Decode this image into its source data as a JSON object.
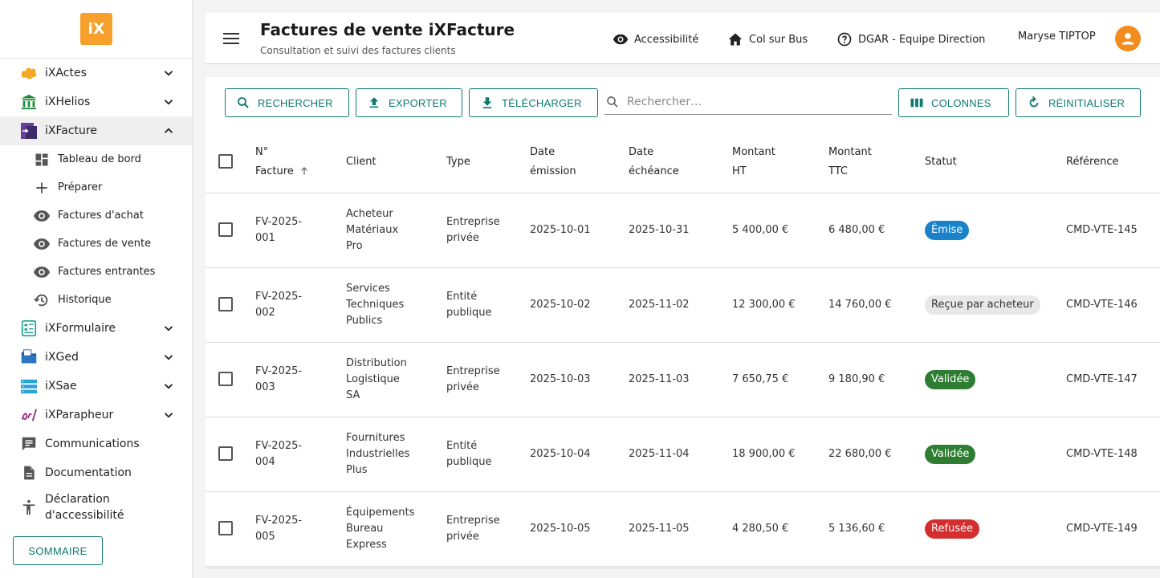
{
  "sidebar": {
    "logo": "iX",
    "items": [
      {
        "label": "iXActes",
        "icon": "ixactes-icon",
        "expanded": false
      },
      {
        "label": "iXHelios",
        "icon": "bank-icon",
        "expanded": false
      },
      {
        "label": "iXFacture",
        "icon": "ixfacture-icon",
        "expanded": true
      }
    ],
    "sub_items": [
      {
        "label": "Tableau de bord",
        "icon": "dashboard-icon"
      },
      {
        "label": "Préparer",
        "icon": "plus-icon"
      },
      {
        "label": "Factures d'achat",
        "icon": "eye-icon"
      },
      {
        "label": "Factures de vente",
        "icon": "eye-icon"
      },
      {
        "label": "Factures entrantes",
        "icon": "eye-icon"
      },
      {
        "label": "Historique",
        "icon": "history-icon"
      }
    ],
    "items2": [
      {
        "label": "iXFormulaire",
        "icon": "form-icon"
      },
      {
        "label": "iXGed",
        "icon": "folder-icon"
      },
      {
        "label": "iXSae",
        "icon": "storage-icon"
      },
      {
        "label": "iXParapheur",
        "icon": "signature-icon"
      },
      {
        "label": "Communications",
        "icon": "chat-icon"
      },
      {
        "label": "Documentation",
        "icon": "document-icon"
      },
      {
        "label": "Déclaration d'accessibilité",
        "icon": "accessibility-icon"
      }
    ],
    "sommaire_label": "SOMMAIRE"
  },
  "header": {
    "title": "Factures de vente iXFacture",
    "subtitle": "Consultation et suivi des factures clients",
    "accessibility": "Accessibilité",
    "home": "Col sur Bus",
    "help": "DGAR - Equipe Direction",
    "user": "Maryse TIPTOP"
  },
  "toolbar": {
    "search_btn": "RECHERCHER",
    "export_btn": "EXPORTER",
    "download_btn": "TÉLÉCHARGER",
    "search_placeholder": "Rechercher…",
    "columns_btn": "COLONNES",
    "reset_btn": "RÉINITIALISER"
  },
  "table": {
    "headers": {
      "num_1": "N°",
      "num_2": "Facture",
      "client": "Client",
      "type": "Type",
      "date_em_1": "Date",
      "date_em_2": "émission",
      "date_ech_1": "Date",
      "date_ech_2": "échéance",
      "ht_1": "Montant",
      "ht_2": "HT",
      "ttc_1": "Montant",
      "ttc_2": "TTC",
      "status": "Statut",
      "ref": "Référence"
    },
    "rows": [
      {
        "num_1": "FV-2025-",
        "num_2": "001",
        "client_1": "Acheteur",
        "client_2": "Matériaux",
        "client_3": "Pro",
        "type_1": "Entreprise",
        "type_2": "privée",
        "date_em": "2025-10-01",
        "date_ech": "2025-10-31",
        "ht": "5 400,00 €",
        "ttc": "6 480,00 €",
        "status": "Émise",
        "status_bg": "#1a82c8",
        "status_fg": "#ffffff",
        "ref": "CMD-VTE-145"
      },
      {
        "num_1": "FV-2025-",
        "num_2": "002",
        "client_1": "Services",
        "client_2": "Techniques",
        "client_3": "Publics",
        "type_1": "Entité",
        "type_2": "publique",
        "date_em": "2025-10-02",
        "date_ech": "2025-11-02",
        "ht": "12 300,00 €",
        "ttc": "14 760,00 €",
        "status": "Reçue par acheteur",
        "status_bg": "#e8e8e8",
        "status_fg": "#333333",
        "ref": "CMD-VTE-146"
      },
      {
        "num_1": "FV-2025-",
        "num_2": "003",
        "client_1": "Distribution",
        "client_2": "Logistique",
        "client_3": "SA",
        "type_1": "Entreprise",
        "type_2": "privée",
        "date_em": "2025-10-03",
        "date_ech": "2025-11-03",
        "ht": "7 650,75 €",
        "ttc": "9 180,90 €",
        "status": "Validée",
        "status_bg": "#2e7d32",
        "status_fg": "#ffffff",
        "ref": "CMD-VTE-147"
      },
      {
        "num_1": "FV-2025-",
        "num_2": "004",
        "client_1": "Fournitures",
        "client_2": "Industrielles",
        "client_3": "Plus",
        "type_1": "Entité",
        "type_2": "publique",
        "date_em": "2025-10-04",
        "date_ech": "2025-11-04",
        "ht": "18 900,00 €",
        "ttc": "22 680,00 €",
        "status": "Validée",
        "status_bg": "#2e7d32",
        "status_fg": "#ffffff",
        "ref": "CMD-VTE-148"
      },
      {
        "num_1": "FV-2025-",
        "num_2": "005",
        "client_1": "Équipements",
        "client_2": "Bureau",
        "client_3": "Express",
        "type_1": "Entreprise",
        "type_2": "privée",
        "date_em": "2025-10-05",
        "date_ech": "2025-11-05",
        "ht": "4 280,50 €",
        "ttc": "5 136,60 €",
        "status": "Refusée",
        "status_bg": "#d32f2f",
        "status_fg": "#ffffff",
        "ref": "CMD-VTE-149"
      }
    ]
  }
}
